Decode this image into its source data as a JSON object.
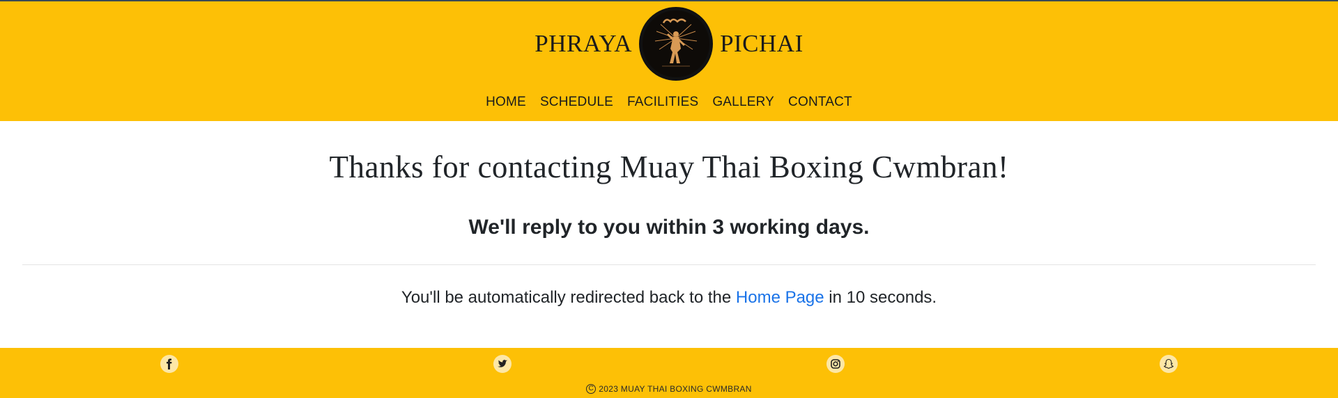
{
  "brand": {
    "left_word": "PHRAYA",
    "right_word": "PICHAI",
    "logo_icon": "muay-thai-fighter-logo"
  },
  "nav": {
    "items": [
      "HOME",
      "SCHEDULE",
      "FACILITIES",
      "GALLERY",
      "CONTACT"
    ]
  },
  "main": {
    "heading": "Thanks for contacting Muay Thai Boxing Cwmbran!",
    "subheading": "We'll reply to you within 3 working days.",
    "redirect_before": "You'll be automatically redirected back to the ",
    "redirect_link": "Home Page",
    "redirect_after": " in 10 seconds."
  },
  "footer": {
    "social_icons": [
      "facebook-icon",
      "twitter-icon",
      "instagram-icon",
      "snapchat-icon"
    ],
    "copyright": "2023 MUAY THAI BOXING CWMBRAN"
  },
  "colors": {
    "accent": "#fdc006",
    "link": "#1a73e8",
    "text": "#212529"
  }
}
